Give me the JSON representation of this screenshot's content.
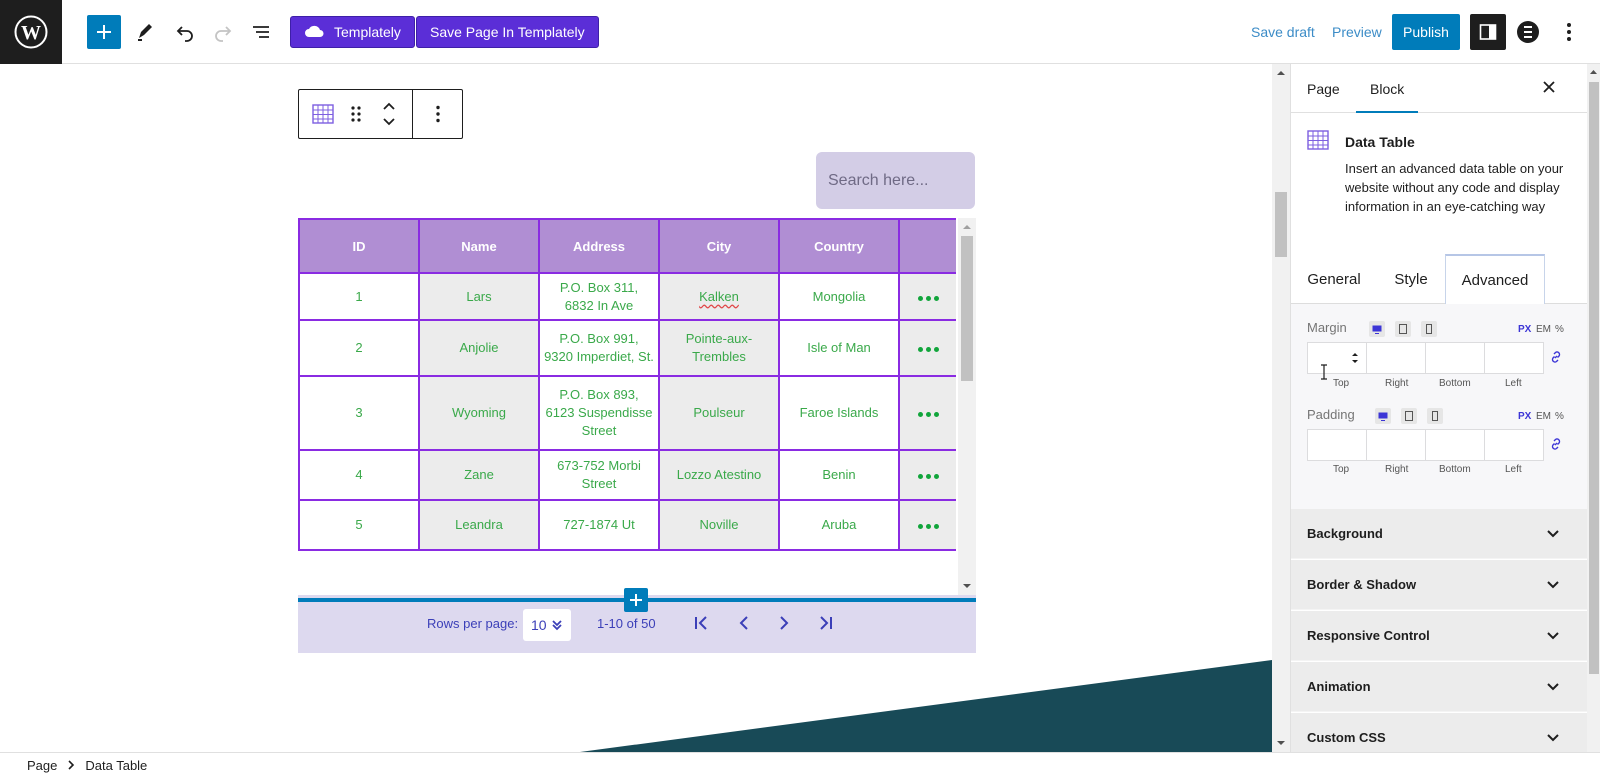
{
  "toolbar": {
    "templately_label": "Templately",
    "save_templately_label": "Save Page In Templately",
    "save_draft_label": "Save draft",
    "preview_label": "Preview",
    "publish_label": "Publish"
  },
  "search": {
    "placeholder": "Search here..."
  },
  "table": {
    "columns": [
      "ID",
      "Name",
      "Address",
      "City",
      "Country",
      ""
    ],
    "rows": [
      {
        "id": "1",
        "name": "Lars",
        "address": "P.O. Box 311, 6832 In Ave",
        "city": "Kalken",
        "country": "Mongolia"
      },
      {
        "id": "2",
        "name": "Anjolie",
        "address": "P.O. Box 991, 9320 Imperdiet, St.",
        "city": "Pointe-aux-Trembles",
        "country": "Isle of Man"
      },
      {
        "id": "3",
        "name": "Wyoming",
        "address": "P.O. Box 893, 6123 Suspendisse Street",
        "city": "Poulseur",
        "country": "Faroe Islands"
      },
      {
        "id": "4",
        "name": "Zane",
        "address": "673-752 Morbi Street",
        "city": "Lozzo Atestino",
        "country": "Benin"
      },
      {
        "id": "5",
        "name": "Leandra",
        "address": "727-1874 Ut",
        "city": "Noville",
        "country": "Aruba"
      }
    ]
  },
  "pagination": {
    "rows_per_page_label": "Rows per page:",
    "rows_per_page_value": "10",
    "range": "1-10 of 50"
  },
  "sidebar": {
    "tabs": {
      "page": "Page",
      "block": "Block"
    },
    "block_title": "Data Table",
    "block_description": "Insert an advanced data table on your website without any code and display information in an eye-catching way",
    "inner_tabs": {
      "general": "General",
      "style": "Style",
      "advanced": "Advanced"
    },
    "margin_label": "Margin",
    "padding_label": "Padding",
    "units": {
      "px": "PX",
      "em": "EM",
      "percent": "%"
    },
    "sides": {
      "top": "Top",
      "right": "Right",
      "bottom": "Bottom",
      "left": "Left"
    },
    "sections": [
      "Background",
      "Border & Shadow",
      "Responsive Control",
      "Animation",
      "Custom CSS"
    ]
  },
  "breadcrumb": {
    "root": "Page",
    "current": "Data Table"
  },
  "colors": {
    "accent": "#007cba",
    "templately_purple": "#5b2ed7",
    "table_border": "#8a2be2",
    "table_header": "#b08ed3",
    "cell_text": "#3aa94a",
    "teal_shape": "#184a57"
  }
}
